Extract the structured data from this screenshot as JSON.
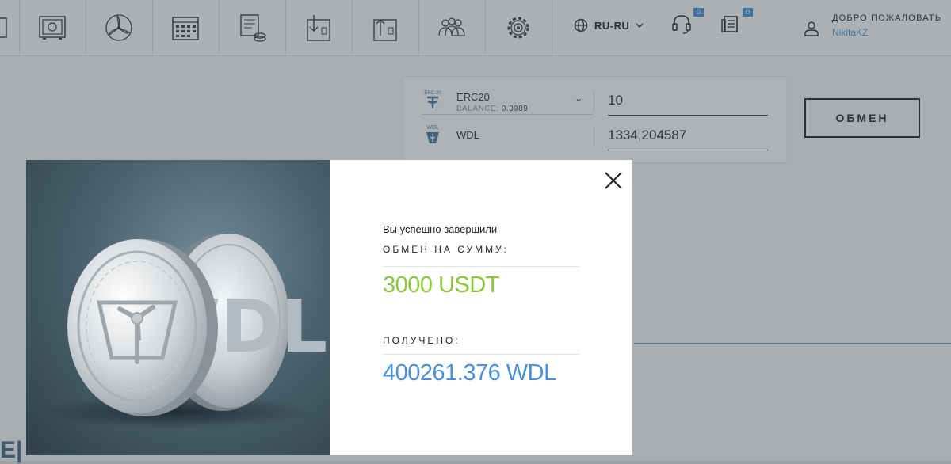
{
  "header": {
    "language": "RU-RU",
    "support_count": "0",
    "news_count": "0",
    "welcome": "ДОБРО ПОЖАЛОВАТЬ",
    "username": "NikitaKZ"
  },
  "exchange": {
    "from": {
      "icon_tag": "ERC-20",
      "name": "ERC20",
      "balance_label": "BALANCE:",
      "balance": "0.3989",
      "amount": "10"
    },
    "to": {
      "icon_tag": "WDL",
      "name": "WDL",
      "amount": "1334,204587"
    },
    "button": "ОБМЕН"
  },
  "modal": {
    "intro": "Вы успешно завершили",
    "sum_label": "ОБМЕН НА СУММУ:",
    "sum_value": "3000 USDT",
    "received_label": "ПОЛУЧЕНО:",
    "received_value": "400261.376 WDL",
    "coin_text": "WDL"
  },
  "colors": {
    "accent_blue": "#4a90d9",
    "accent_green": "#8cc63f"
  }
}
